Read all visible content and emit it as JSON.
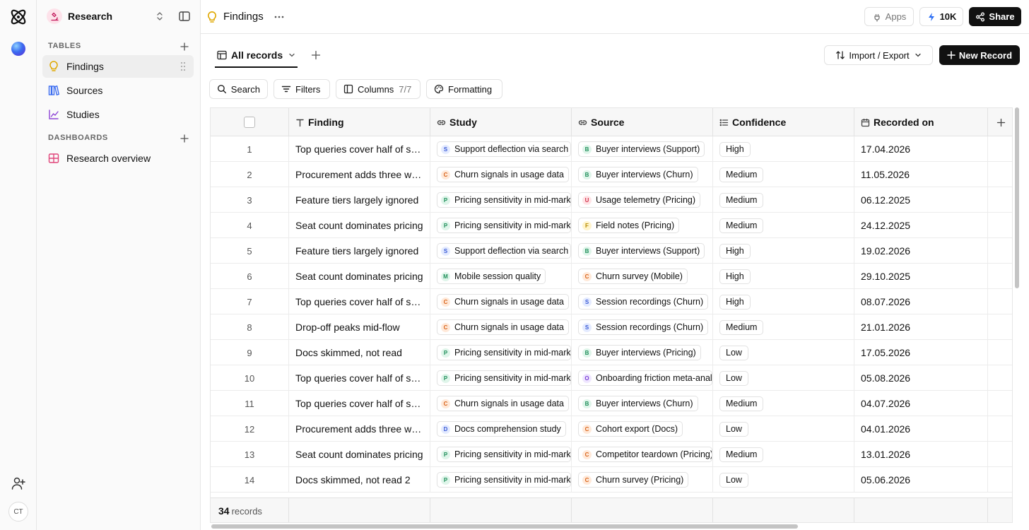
{
  "rail": {
    "avatar_initials": "CT"
  },
  "workspace": {
    "name": "Research"
  },
  "sidebar": {
    "tables_label": "TABLES",
    "dashboards_label": "DASHBOARDS",
    "tables": [
      {
        "label": "Findings",
        "icon": "lightbulb-icon",
        "active": true
      },
      {
        "label": "Sources",
        "icon": "books-icon",
        "active": false
      },
      {
        "label": "Studies",
        "icon": "chart-icon",
        "active": false
      }
    ],
    "dashboards": [
      {
        "label": "Research overview",
        "icon": "grid-icon"
      }
    ]
  },
  "topbar": {
    "title": "Findings",
    "apps_label": "Apps",
    "credits_label": "10K",
    "share_label": "Share"
  },
  "view": {
    "tab_label": "All records",
    "import_export_label": "Import / Export",
    "new_record_label": "New Record"
  },
  "toolbar": {
    "search_label": "Search",
    "filters_label": "Filters",
    "columns_label": "Columns",
    "columns_count": "7/7",
    "formatting_label": "Formatting"
  },
  "table": {
    "columns": [
      "Finding",
      "Study",
      "Source",
      "Confidence",
      "Recorded on"
    ],
    "rows": [
      {
        "n": "1",
        "finding": "Top queries cover half of searches",
        "study": "Support deflection via search",
        "study_i": "S",
        "source": "Buyer interviews (Support)",
        "source_i": "B",
        "confidence": "High",
        "date": "17.04.2026"
      },
      {
        "n": "2",
        "finding": "Procurement adds three weeks",
        "study": "Churn signals in usage data",
        "study_i": "C",
        "source": "Buyer interviews (Churn)",
        "source_i": "B",
        "confidence": "Medium",
        "date": "11.05.2026"
      },
      {
        "n": "3",
        "finding": "Feature tiers largely ignored",
        "study": "Pricing sensitivity in mid-market",
        "study_i": "P",
        "source": "Usage telemetry (Pricing)",
        "source_i": "U",
        "confidence": "Medium",
        "date": "06.12.2025"
      },
      {
        "n": "4",
        "finding": "Seat count dominates pricing",
        "study": "Pricing sensitivity in mid-market",
        "study_i": "P",
        "source": "Field notes (Pricing)",
        "source_i": "F",
        "confidence": "Medium",
        "date": "24.12.2025"
      },
      {
        "n": "5",
        "finding": "Feature tiers largely ignored",
        "study": "Support deflection via search",
        "study_i": "S",
        "source": "Buyer interviews (Support)",
        "source_i": "B",
        "confidence": "High",
        "date": "19.02.2026"
      },
      {
        "n": "6",
        "finding": "Seat count dominates pricing",
        "study": "Mobile session quality",
        "study_i": "M",
        "source": "Churn survey (Mobile)",
        "source_i": "C",
        "confidence": "High",
        "date": "29.10.2025"
      },
      {
        "n": "7",
        "finding": "Top queries cover half of searches",
        "study": "Churn signals in usage data",
        "study_i": "C",
        "source": "Session recordings (Churn)",
        "source_i": "S",
        "confidence": "High",
        "date": "08.07.2026"
      },
      {
        "n": "8",
        "finding": "Drop-off peaks mid-flow",
        "study": "Churn signals in usage data",
        "study_i": "C",
        "source": "Session recordings (Churn)",
        "source_i": "S",
        "confidence": "Medium",
        "date": "21.01.2026"
      },
      {
        "n": "9",
        "finding": "Docs skimmed, not read",
        "study": "Pricing sensitivity in mid-market",
        "study_i": "P",
        "source": "Buyer interviews (Pricing)",
        "source_i": "B",
        "confidence": "Low",
        "date": "17.05.2026"
      },
      {
        "n": "10",
        "finding": "Top queries cover half of searches",
        "study": "Pricing sensitivity in mid-market",
        "study_i": "P",
        "source": "Onboarding friction meta-analysis",
        "source_i": "O",
        "confidence": "Low",
        "date": "05.08.2026"
      },
      {
        "n": "11",
        "finding": "Top queries cover half of searches",
        "study": "Churn signals in usage data",
        "study_i": "C",
        "source": "Buyer interviews (Churn)",
        "source_i": "B",
        "confidence": "Medium",
        "date": "04.07.2026"
      },
      {
        "n": "12",
        "finding": "Procurement adds three weeks",
        "study": "Docs comprehension study",
        "study_i": "D",
        "source": "Cohort export (Docs)",
        "source_i": "C",
        "confidence": "Low",
        "date": "04.01.2026"
      },
      {
        "n": "13",
        "finding": "Seat count dominates pricing",
        "study": "Pricing sensitivity in mid-market",
        "study_i": "P",
        "source": "Competitor teardown (Pricing)",
        "source_i": "C",
        "confidence": "Medium",
        "date": "13.01.2026"
      },
      {
        "n": "14",
        "finding": "Docs skimmed, not read 2",
        "study": "Pricing sensitivity in mid-market",
        "study_i": "P",
        "source": "Churn survey (Pricing)",
        "source_i": "C",
        "confidence": "Low",
        "date": "05.06.2026"
      }
    ],
    "record_count": "34",
    "record_count_suffix": "records"
  },
  "colors": {
    "accent_dark": "#111111",
    "initial_S": "#e4ebff",
    "initial_C": "#ffe9d9",
    "initial_P": "#dff5ea",
    "initial_M": "#dff5ea",
    "initial_D": "#e4ebff",
    "initial_B": "#dff5ea",
    "initial_U": "#ffe3e6",
    "initial_F": "#fff4cc",
    "initial_O": "#efe6ff"
  }
}
